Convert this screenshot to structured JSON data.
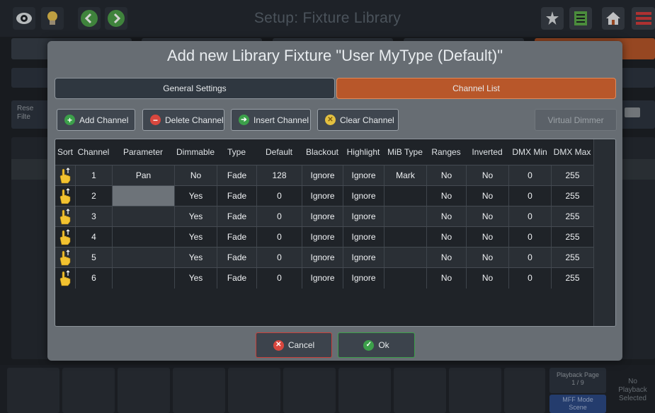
{
  "app": {
    "title": "Setup: Fixture Library"
  },
  "background": {
    "side_labels": [
      "Rese",
      "Filte"
    ],
    "playback": {
      "page_label": "Playback Page",
      "page_value": "1 / 9",
      "mode_label": "MFF Mode",
      "mode_value": "Scene"
    },
    "no_playback": [
      "No",
      "Playback",
      "Selected"
    ]
  },
  "dialog": {
    "title": "Add new Library Fixture \"User MyType (Default)\"",
    "tabs": [
      {
        "label": "General Settings",
        "active": false
      },
      {
        "label": "Channel List",
        "active": true
      }
    ],
    "toolbar": {
      "add": "Add Channel",
      "delete": "Delete Channel",
      "insert": "Insert Channel",
      "clear": "Clear Channel",
      "virtual_dimmer": "Virtual Dimmer"
    },
    "columns": [
      "Sort",
      "Channel",
      "Parameter",
      "Dimmable",
      "Type",
      "Default",
      "Blackout",
      "Highlight",
      "MiB Type",
      "Ranges",
      "Inverted",
      "DMX Min",
      "DMX Max"
    ],
    "rows": [
      [
        "1",
        "Pan",
        "No",
        "Fade",
        "128",
        "Ignore",
        "Ignore",
        "Mark",
        "No",
        "No",
        "0",
        "255"
      ],
      [
        "2",
        "",
        "Yes",
        "Fade",
        "0",
        "Ignore",
        "Ignore",
        "",
        "No",
        "No",
        "0",
        "255"
      ],
      [
        "3",
        "",
        "Yes",
        "Fade",
        "0",
        "Ignore",
        "Ignore",
        "",
        "No",
        "No",
        "0",
        "255"
      ],
      [
        "4",
        "",
        "Yes",
        "Fade",
        "0",
        "Ignore",
        "Ignore",
        "",
        "No",
        "No",
        "0",
        "255"
      ],
      [
        "5",
        "",
        "Yes",
        "Fade",
        "0",
        "Ignore",
        "Ignore",
        "",
        "No",
        "No",
        "0",
        "255"
      ],
      [
        "6",
        "",
        "Yes",
        "Fade",
        "0",
        "Ignore",
        "Ignore",
        "",
        "No",
        "No",
        "0",
        "255"
      ]
    ],
    "cancel": "Cancel",
    "ok": "Ok"
  },
  "colors": {
    "accent": "#b8572a",
    "row_dark": "#1f2328",
    "row_mid": "#2a2f35"
  }
}
